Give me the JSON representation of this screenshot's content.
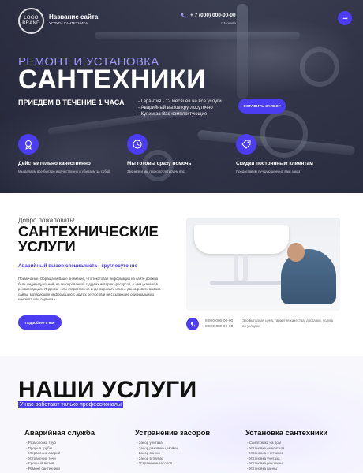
{
  "header": {
    "logo_line1": "LOGO",
    "logo_line2": "BRAND",
    "site_title": "Название сайта",
    "site_subtitle": "УСЛУГИ САНТЕХНИКА",
    "phone": "+ 7 (000) 000-00-00",
    "city": "г. Москва",
    "menu_icon": "hamburger-icon"
  },
  "hero": {
    "line1": "РЕМОНТ И УСТАНОВКА",
    "line2": "САНТЕХНИКИ",
    "line3": "ПРИЕДЕМ В ТЕЧЕНИЕ 1 ЧАСА",
    "guarantees": [
      "- Гарантия - 12 месяцев на все услуги",
      "- Аварийный вызов круглосуточно",
      "- Купим за Вас комплектующие"
    ],
    "cta_label": "ОСТАВИТЬ ЗАЯВКУ"
  },
  "features": [
    {
      "icon": "quality-badge-icon",
      "title": "Действительно качественно",
      "desc": "Мы делаем все быстро и качественно и убираем за собой"
    },
    {
      "icon": "clock-help-icon",
      "title": "Мы готовы сразу помочь",
      "desc": "Звоните и мы проконсультируем вас"
    },
    {
      "icon": "discount-tag-icon",
      "title": "Скидки постоянным клиентам",
      "desc": "Предоставим лучшую цену на ваш заказ"
    }
  ],
  "about": {
    "kicker": "Добро пожаловать!",
    "title": "САНТЕХНИЧЕСКИЕ УСЛУГИ",
    "accent": "Аварийный вызов специалиста - круглосуточно",
    "text": "Примечание. Обращаем Ваше внимание, что текстовая информация на сайте должна быть индивидуальной, не скопированной с других интернет-ресурсов, о чем указано в рекомендациях Яндекса: «Мы стараемся не индексировать или не ранжировать высоко сайты, копирующие информацию с других ресурсов и не создающие оригинального контента или сервиса».",
    "button_label": "Подробнее о нас",
    "phones": [
      "8 800 000-00-00",
      "8 800 000-00-00"
    ],
    "note": "Это выгодная цена, гарантия качества, доставка, услуга по укладке"
  },
  "services": {
    "title": "НАШИ УСЛУГИ",
    "subtitle": "У нас работают только профессионалы",
    "columns": [
      {
        "title": "Аварийная служба",
        "items": [
          "- Разморозка труб",
          "- Прорыв трубы",
          "- Устранение аварий",
          "- Устранение течи",
          "- Срочный вызов",
          "- Ремонт сантехники"
        ]
      },
      {
        "title": "Устранение засоров",
        "items": [
          "- Засор унитаза",
          "- Засор раковины, мойки",
          "- Засор ванны",
          "- Засор в трубах",
          "- Устранение засоров"
        ]
      },
      {
        "title": "Установка сантехники",
        "items": [
          "- Сантехника на дом",
          "- Установка смесителя",
          "- Установка счетчиков",
          "- Установка унитаза",
          "- Установка раковины",
          "- Установка ванны"
        ]
      }
    ]
  },
  "colors": {
    "accent": "#4c3df2",
    "hero_dark": "#3c3f52",
    "accent_light_text": "#9f98ff"
  }
}
